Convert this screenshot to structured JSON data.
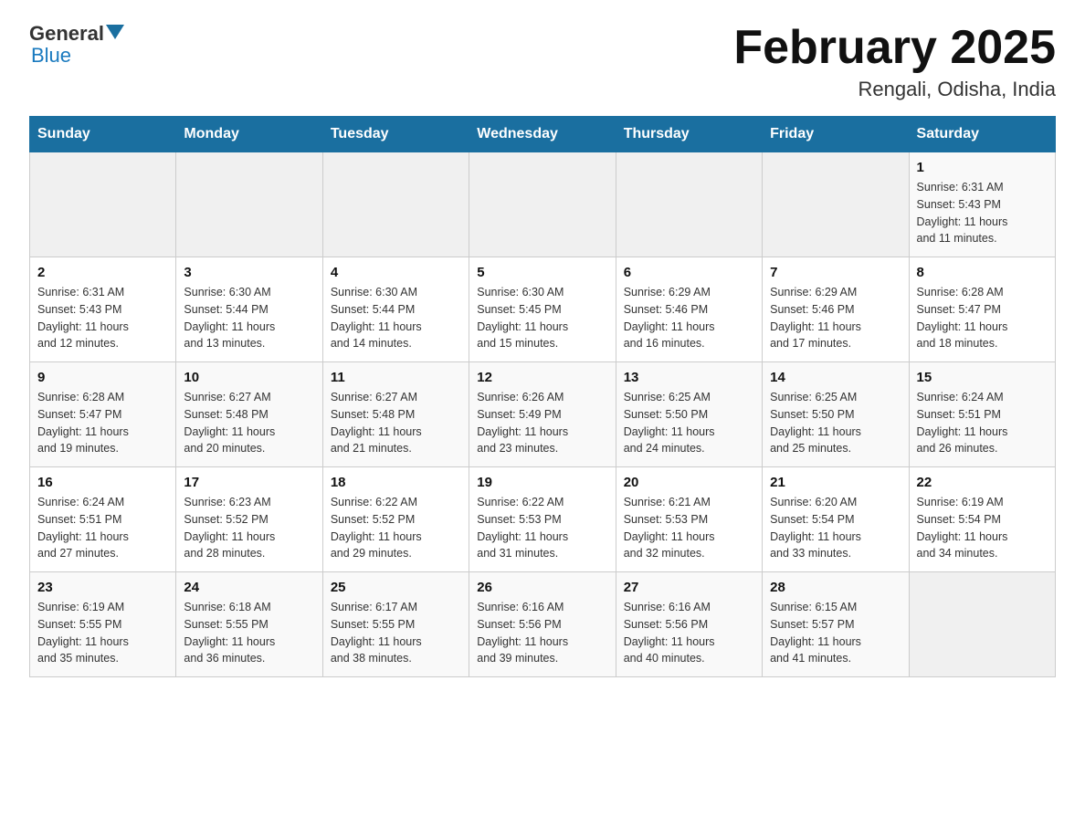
{
  "logo": {
    "general": "General",
    "blue": "Blue"
  },
  "title": {
    "month": "February 2025",
    "location": "Rengali, Odisha, India"
  },
  "headers": [
    "Sunday",
    "Monday",
    "Tuesday",
    "Wednesday",
    "Thursday",
    "Friday",
    "Saturday"
  ],
  "weeks": [
    [
      {
        "day": "",
        "info": ""
      },
      {
        "day": "",
        "info": ""
      },
      {
        "day": "",
        "info": ""
      },
      {
        "day": "",
        "info": ""
      },
      {
        "day": "",
        "info": ""
      },
      {
        "day": "",
        "info": ""
      },
      {
        "day": "1",
        "info": "Sunrise: 6:31 AM\nSunset: 5:43 PM\nDaylight: 11 hours\nand 11 minutes."
      }
    ],
    [
      {
        "day": "2",
        "info": "Sunrise: 6:31 AM\nSunset: 5:43 PM\nDaylight: 11 hours\nand 12 minutes."
      },
      {
        "day": "3",
        "info": "Sunrise: 6:30 AM\nSunset: 5:44 PM\nDaylight: 11 hours\nand 13 minutes."
      },
      {
        "day": "4",
        "info": "Sunrise: 6:30 AM\nSunset: 5:44 PM\nDaylight: 11 hours\nand 14 minutes."
      },
      {
        "day": "5",
        "info": "Sunrise: 6:30 AM\nSunset: 5:45 PM\nDaylight: 11 hours\nand 15 minutes."
      },
      {
        "day": "6",
        "info": "Sunrise: 6:29 AM\nSunset: 5:46 PM\nDaylight: 11 hours\nand 16 minutes."
      },
      {
        "day": "7",
        "info": "Sunrise: 6:29 AM\nSunset: 5:46 PM\nDaylight: 11 hours\nand 17 minutes."
      },
      {
        "day": "8",
        "info": "Sunrise: 6:28 AM\nSunset: 5:47 PM\nDaylight: 11 hours\nand 18 minutes."
      }
    ],
    [
      {
        "day": "9",
        "info": "Sunrise: 6:28 AM\nSunset: 5:47 PM\nDaylight: 11 hours\nand 19 minutes."
      },
      {
        "day": "10",
        "info": "Sunrise: 6:27 AM\nSunset: 5:48 PM\nDaylight: 11 hours\nand 20 minutes."
      },
      {
        "day": "11",
        "info": "Sunrise: 6:27 AM\nSunset: 5:48 PM\nDaylight: 11 hours\nand 21 minutes."
      },
      {
        "day": "12",
        "info": "Sunrise: 6:26 AM\nSunset: 5:49 PM\nDaylight: 11 hours\nand 23 minutes."
      },
      {
        "day": "13",
        "info": "Sunrise: 6:25 AM\nSunset: 5:50 PM\nDaylight: 11 hours\nand 24 minutes."
      },
      {
        "day": "14",
        "info": "Sunrise: 6:25 AM\nSunset: 5:50 PM\nDaylight: 11 hours\nand 25 minutes."
      },
      {
        "day": "15",
        "info": "Sunrise: 6:24 AM\nSunset: 5:51 PM\nDaylight: 11 hours\nand 26 minutes."
      }
    ],
    [
      {
        "day": "16",
        "info": "Sunrise: 6:24 AM\nSunset: 5:51 PM\nDaylight: 11 hours\nand 27 minutes."
      },
      {
        "day": "17",
        "info": "Sunrise: 6:23 AM\nSunset: 5:52 PM\nDaylight: 11 hours\nand 28 minutes."
      },
      {
        "day": "18",
        "info": "Sunrise: 6:22 AM\nSunset: 5:52 PM\nDaylight: 11 hours\nand 29 minutes."
      },
      {
        "day": "19",
        "info": "Sunrise: 6:22 AM\nSunset: 5:53 PM\nDaylight: 11 hours\nand 31 minutes."
      },
      {
        "day": "20",
        "info": "Sunrise: 6:21 AM\nSunset: 5:53 PM\nDaylight: 11 hours\nand 32 minutes."
      },
      {
        "day": "21",
        "info": "Sunrise: 6:20 AM\nSunset: 5:54 PM\nDaylight: 11 hours\nand 33 minutes."
      },
      {
        "day": "22",
        "info": "Sunrise: 6:19 AM\nSunset: 5:54 PM\nDaylight: 11 hours\nand 34 minutes."
      }
    ],
    [
      {
        "day": "23",
        "info": "Sunrise: 6:19 AM\nSunset: 5:55 PM\nDaylight: 11 hours\nand 35 minutes."
      },
      {
        "day": "24",
        "info": "Sunrise: 6:18 AM\nSunset: 5:55 PM\nDaylight: 11 hours\nand 36 minutes."
      },
      {
        "day": "25",
        "info": "Sunrise: 6:17 AM\nSunset: 5:55 PM\nDaylight: 11 hours\nand 38 minutes."
      },
      {
        "day": "26",
        "info": "Sunrise: 6:16 AM\nSunset: 5:56 PM\nDaylight: 11 hours\nand 39 minutes."
      },
      {
        "day": "27",
        "info": "Sunrise: 6:16 AM\nSunset: 5:56 PM\nDaylight: 11 hours\nand 40 minutes."
      },
      {
        "day": "28",
        "info": "Sunrise: 6:15 AM\nSunset: 5:57 PM\nDaylight: 11 hours\nand 41 minutes."
      },
      {
        "day": "",
        "info": ""
      }
    ]
  ]
}
